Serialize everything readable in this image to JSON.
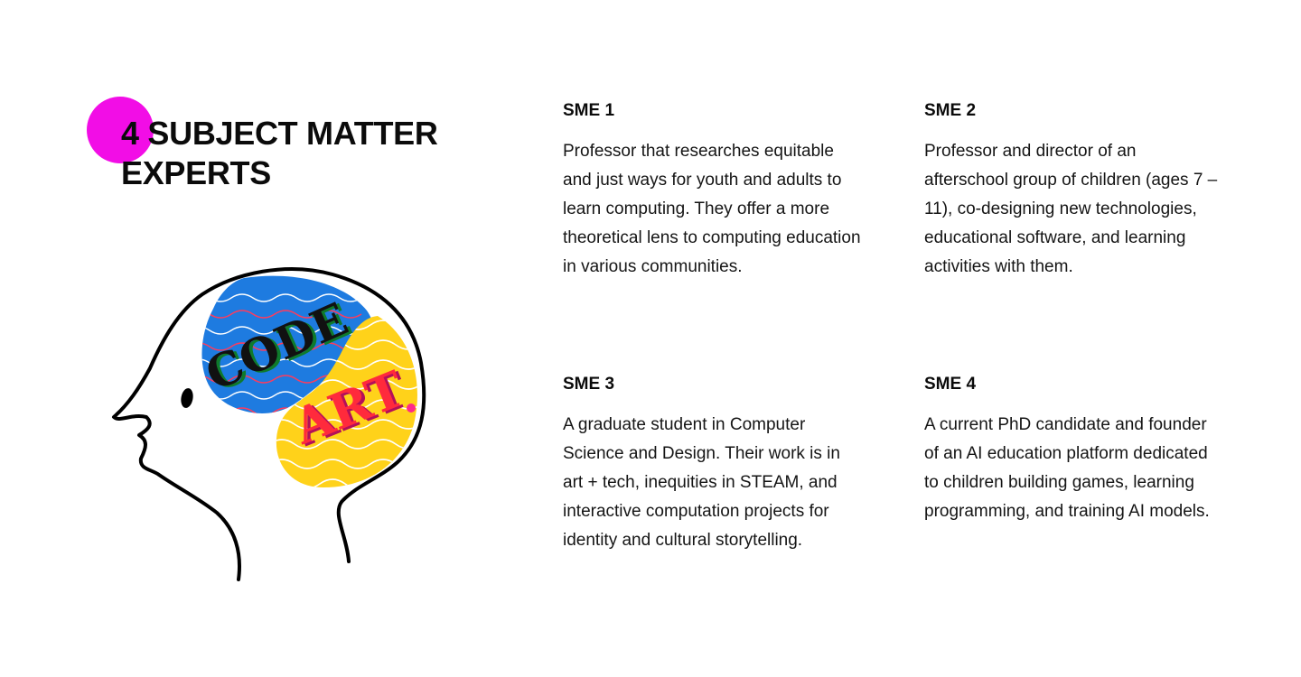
{
  "header": {
    "title_line1": "4 SUBJECT MATTER",
    "title_line2": "EXPERTS",
    "accent_color": "#f20de6"
  },
  "illustration": {
    "icon": "head-brain-icon",
    "brain_words": [
      "CODE",
      "ART"
    ],
    "colors": {
      "outline": "#000000",
      "blue": "#1e7be0",
      "yellow": "#ffd21a",
      "red": "#ff2a3c",
      "green": "#0f7a2c",
      "wave_white": "#ffffff",
      "wave_red": "#ff3b5c"
    }
  },
  "smes": [
    {
      "label": "SME 1",
      "description": "Professor that researches equitable and just ways for youth and adults to learn computing. They offer a more theoretical lens to computing education in various communities."
    },
    {
      "label": "SME 2",
      "description": "Professor and director of an afterschool group of children (ages 7 – 11), co-designing new technologies, educational software, and learning activities with them."
    },
    {
      "label": "SME 3",
      "description": "A graduate student in Computer Science and Design. Their work is in art + tech, inequities in STEAM, and interactive computation projects for identity and cultural storytelling."
    },
    {
      "label": "SME 4",
      "description": "A current PhD candidate and founder of an AI education platform dedicated to children building games, learning programming, and training AI models."
    }
  ]
}
